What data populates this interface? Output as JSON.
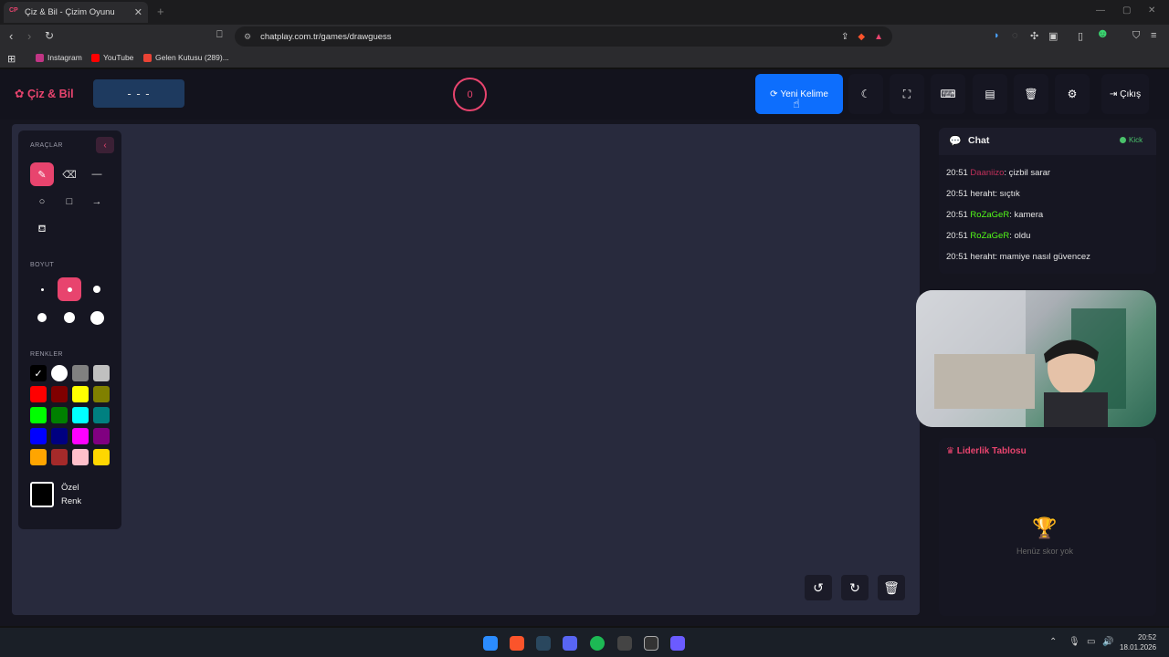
{
  "browser": {
    "tab_title": "Çiz & Bil - Çizim Oyunu",
    "tab_favicon": "CP",
    "url": "chatplay.com.tr/games/drawguess",
    "bookmarks": [
      {
        "label": "Instagram",
        "color": "#c13584"
      },
      {
        "label": "YouTube",
        "color": "#ff0000"
      },
      {
        "label": "Gelen Kutusu (289)...",
        "color": "#ea4335"
      }
    ]
  },
  "header": {
    "logo": "Çiz & Bil",
    "word": "- - -",
    "timer": "0",
    "new_word_label": "Yeni Kelime",
    "exit_label": "Çıkış"
  },
  "tools": {
    "section_tools": "ARAÇLAR",
    "section_size": "BOYUT",
    "section_colors": "RENKLER",
    "custom_color": "Özel Renk",
    "colors": [
      "#000000",
      "#ffffff",
      "#808080",
      "#c0c0c0",
      "#ff0000",
      "#800000",
      "#ffff00",
      "#808000",
      "#00ff00",
      "#008000",
      "#00ffff",
      "#008080",
      "#0000ff",
      "#000080",
      "#ff00ff",
      "#800080",
      "#ffa500",
      "#a52a2a",
      "#ffc0cb",
      "#ffd700"
    ]
  },
  "chat": {
    "title": "Chat",
    "platform": "Kick",
    "messages": [
      {
        "time": "20:51",
        "user": "Daaniizo",
        "user_color": "#c0305a",
        "text": ": çizbil sarar"
      },
      {
        "time": "20:51",
        "user": "heraht",
        "user_color": "#e6e6e6",
        "text": ": sıçtık"
      },
      {
        "time": "20:51",
        "user": "RoZaGeR",
        "user_color": "#53fc18",
        "text": ": kamera"
      },
      {
        "time": "20:51",
        "user": "RoZaGeR",
        "user_color": "#53fc18",
        "text": ": oldu"
      },
      {
        "time": "20:51",
        "user": "heraht",
        "user_color": "#e6e6e6",
        "text": ": mamiye nasıl güvencez"
      }
    ]
  },
  "leaderboard": {
    "title": "Liderlik Tablosu",
    "empty": "Henüz skor yok"
  },
  "taskbar": {
    "time": "20:52",
    "date": "18.01.2026"
  }
}
